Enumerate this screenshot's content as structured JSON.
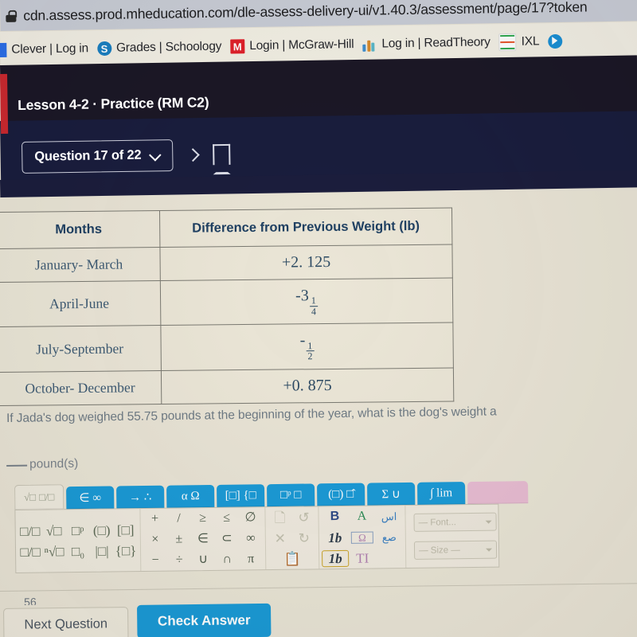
{
  "browser": {
    "url": "cdn.assess.prod.mheducation.com/dle-assess-delivery-ui/v1.40.3/assessment/page/17?token",
    "lock_icon": "lock-icon",
    "bookmarks": [
      {
        "label": "Clever | Log in",
        "icon": "clever-favicon"
      },
      {
        "label": "Grades | Schoology",
        "icon": "schoology-favicon",
        "glyph": "S"
      },
      {
        "label": "Login | McGraw-Hill",
        "icon": "mcgraw-hill-favicon",
        "glyph": "M"
      },
      {
        "label": "Log in | ReadTheory",
        "icon": "readtheory-favicon"
      },
      {
        "label": "IXL",
        "icon": "ixl-favicon"
      },
      {
        "label": "",
        "icon": "edpuzzle-favicon"
      }
    ]
  },
  "app": {
    "lesson_title": "Lesson 4-2 · Practice (RM C2)",
    "question_selector": "Question 17 of 22",
    "chevron_down_icon": "chevron-down-icon",
    "next_arrow_icon": "chevron-right-icon",
    "bookmark_icon": "bookmark-icon"
  },
  "table": {
    "headers": [
      "Months",
      "Difference from Previous Weight (lb)"
    ],
    "rows": [
      {
        "months": "January- March",
        "difference": "+2. 125"
      },
      {
        "months": "April-June",
        "difference": "-3",
        "frac_num": "1",
        "frac_den": "4"
      },
      {
        "months": "July-September",
        "difference": "-",
        "frac_num": "1",
        "frac_den": "2"
      },
      {
        "months": "October- December",
        "difference": "+0. 875"
      }
    ]
  },
  "question": {
    "prompt": "If Jada's dog weighed 55.75 pounds at the beginning of the year, what is the dog's weight a",
    "answer_unit": "pound(s)",
    "partial_value": "56"
  },
  "math_toolbar": {
    "tabs": [
      {
        "id": "tab-basic",
        "label": "√□",
        "label2": "□/□",
        "selected": true
      },
      {
        "id": "tab-sets",
        "label": "∈ ∞",
        "selected": false
      },
      {
        "id": "tab-arrows",
        "label": "→ ∴",
        "selected": false
      },
      {
        "id": "tab-greek",
        "label": "α Ω",
        "selected": false
      },
      {
        "id": "tab-matrix",
        "label": "[□] {□",
        "selected": false
      },
      {
        "id": "tab-geometry",
        "label": "□ᵖ □",
        "selected": false
      },
      {
        "id": "tab-grouping",
        "label": "(□) □̂",
        "selected": false
      },
      {
        "id": "tab-sigma",
        "label": "Σ ∪",
        "selected": false
      },
      {
        "id": "tab-calculus",
        "label": "∫ lim",
        "selected": false
      },
      {
        "id": "tab-color",
        "label": "",
        "selected": false,
        "pink": true
      }
    ],
    "group_fractions": [
      "□/□",
      "√□",
      "□ᵖ",
      "(□)",
      "[□]",
      "□/□",
      "ⁿ√□",
      "□₀",
      "|□|",
      "{□}"
    ],
    "group_operators": [
      "+",
      "/",
      "≥",
      "≤",
      "∅",
      "×",
      "±",
      "∈",
      "⊂",
      "∞",
      "−",
      "÷",
      "∪",
      "∩",
      "π"
    ],
    "group_clipboard": [
      "copy-icon",
      "undo-icon",
      "cut-icon",
      "redo-icon",
      "paste-icon"
    ],
    "group_format": [
      "B",
      "A",
      "arabic-icon",
      "1b",
      "Ω",
      "arabic2-icon",
      "1b",
      "TI"
    ],
    "font_select": "— Font...",
    "size_select": "— Size —"
  },
  "footer": {
    "next_question": "Next Question",
    "check_answer": "Check Answer"
  },
  "colors": {
    "accent_blue": "#1b9ad6",
    "header_dark": "#1b1726",
    "nav_dark": "#191d3d",
    "red_strip": "#c1272d",
    "paper": "#e9e4d5",
    "table_text": "#3d5a73"
  }
}
